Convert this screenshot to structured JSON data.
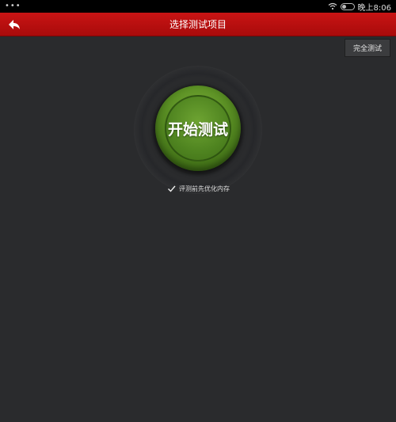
{
  "status_bar": {
    "dots": "•••",
    "time": "晚上8:06",
    "icons": [
      "wifi-icon",
      "toggle-icon"
    ]
  },
  "header": {
    "title": "选择测试项目",
    "back_icon": "back-arrow-icon",
    "color": "#c01010"
  },
  "toolbar": {
    "full_test_label": "完全测试"
  },
  "main": {
    "start_label": "开始测试",
    "start_color": "#5c9125",
    "optimize_label": "评测前先优化内存",
    "optimize_checked": true
  }
}
